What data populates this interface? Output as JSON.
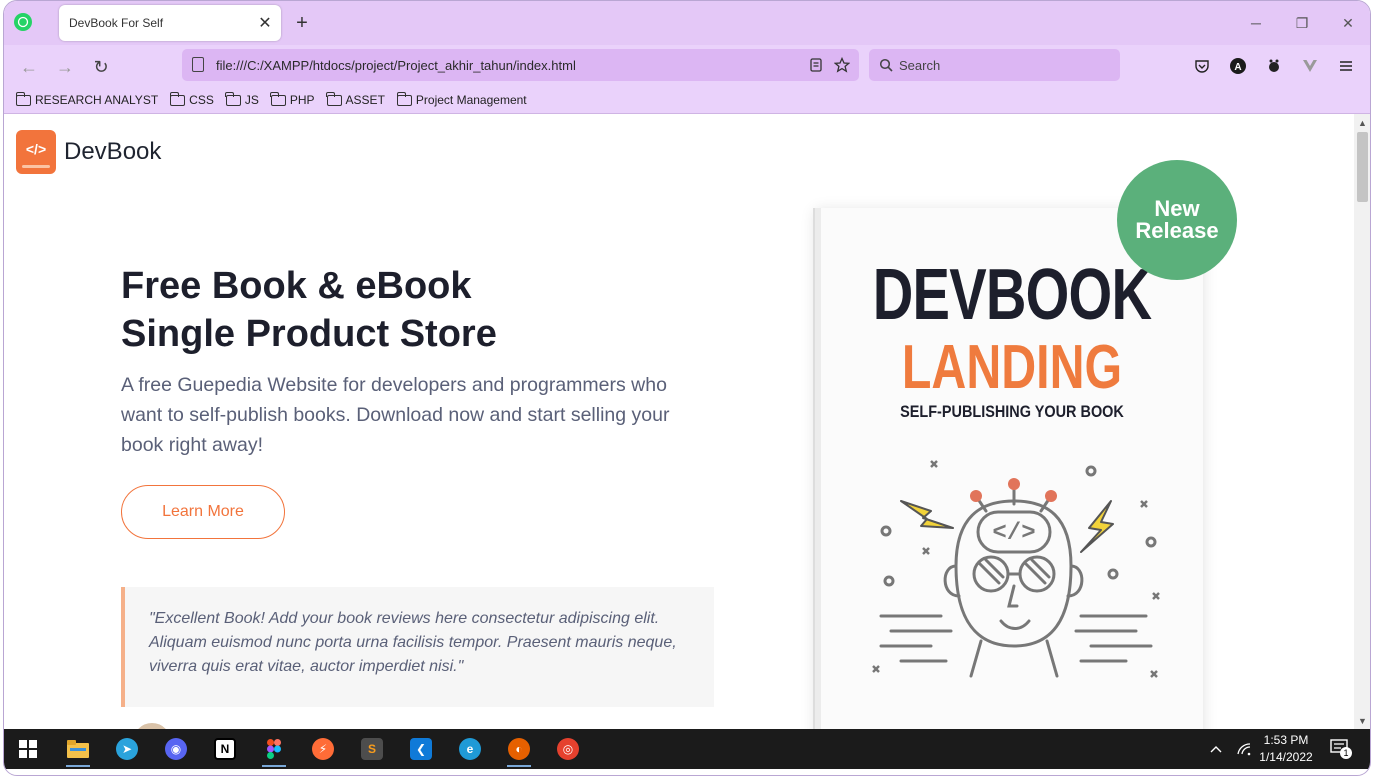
{
  "browser": {
    "tab_title": "DevBook For Self",
    "tab_close": "✕",
    "new_tab": "+",
    "url": "file:///C:/XAMPP/htdocs/project/Project_akhir_tahun/index.html",
    "search_placeholder": "Search",
    "window_controls": {
      "minimize": "─",
      "restore": "❐",
      "close": "✕"
    },
    "nav": {
      "back": "←",
      "forward": "→",
      "reload": "↻"
    },
    "bookmarks": [
      "RESEARCH ANALYST",
      "CSS",
      "JS",
      "PHP",
      "ASSET",
      "Project Management"
    ]
  },
  "page": {
    "logo_text": "DevBook",
    "logo_mark": "</>",
    "hero": {
      "title_line1": "Free Book & eBook",
      "title_line2": "Single Product Store",
      "description": "A free Guepedia Website for developers and programmers who want to self-publish books. Download now and start selling your book right away!",
      "cta_label": "Learn More"
    },
    "quote": "\"Excellent Book! Add your book reviews here consectetur adipiscing elit. Aliquam euismod nunc porta urna facilisis tempor. Praesent mauris neque, viverra quis erat vitae, auctor imperdiet nisi.\"",
    "book": {
      "title": "DEVBOOK",
      "subtitle": "LANDING",
      "tagline": "SELF-PUBLISHING YOUR BOOK",
      "art_code_glyph": "</>"
    },
    "badge": {
      "line1": "New",
      "line2": "Release"
    }
  },
  "taskbar": {
    "time": "1:53 PM",
    "date": "1/14/2022",
    "notification_count": "1",
    "apps": [
      {
        "name": "file-explorer",
        "color": "#f3c04a",
        "glyph": ""
      },
      {
        "name": "telegram",
        "color": "#2aa3dc",
        "glyph": "➤"
      },
      {
        "name": "discord",
        "color": "#5865f2",
        "glyph": "◉"
      },
      {
        "name": "notion",
        "color": "#ffffff",
        "glyph": "N"
      },
      {
        "name": "figma",
        "color": "#1e1e1e",
        "glyph": "F"
      },
      {
        "name": "postman",
        "color": "#ff6c37",
        "glyph": "⚡"
      },
      {
        "name": "sublime-text",
        "color": "#4d4d4d",
        "glyph": "S"
      },
      {
        "name": "vs-code",
        "color": "#0f7ad8",
        "glyph": "❮"
      },
      {
        "name": "edge",
        "color": "#1f9ad6",
        "glyph": "e"
      },
      {
        "name": "firefox",
        "color": "#e66000",
        "glyph": "◐"
      },
      {
        "name": "chrome",
        "color": "#e5412e",
        "glyph": "◎"
      }
    ]
  },
  "colors": {
    "accent": "#f2743c",
    "badge": "#5bb07b",
    "browser_chrome": "#e4c8f7",
    "heading": "#1d1f2c",
    "body_text": "#5a6078"
  }
}
